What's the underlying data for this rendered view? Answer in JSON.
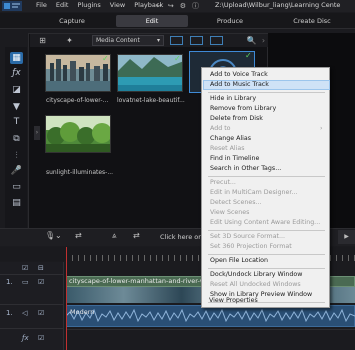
{
  "titlebar": {
    "menus": [
      "File",
      "Edit",
      "Plugins",
      "View",
      "Playback"
    ],
    "file_path": "Z:\\Upload\\Wilbur_liang\\Learning Cente"
  },
  "modes": {
    "capture": "Capture",
    "edit": "Edit",
    "produce": "Produce",
    "create_disc": "Create Disc"
  },
  "library": {
    "dropdown_value": "Media Content",
    "items": [
      {
        "caption": "cityscape-of-lower-...",
        "checked": true
      },
      {
        "caption": "lovatnet-lake-beautif...",
        "checked": true
      },
      {
        "caption": "sunlight-illuminates-...",
        "checked": false
      }
    ],
    "selected_item_checked": true
  },
  "context_menu": {
    "items": [
      {
        "label": "Add to Voice Track",
        "enabled": true
      },
      {
        "label": "Add to Music Track",
        "enabled": true,
        "highlighted": true
      },
      {
        "label": "Hide in Library",
        "enabled": true
      },
      {
        "label": "Remove from Library",
        "enabled": true
      },
      {
        "label": "Delete from Disk",
        "enabled": true
      },
      {
        "label": "Add to",
        "enabled": false
      },
      {
        "label": "Change Alias",
        "enabled": true
      },
      {
        "label": "Reset Alias",
        "enabled": false
      },
      {
        "label": "Find in Timeline",
        "enabled": true
      },
      {
        "label": "Search in Other Tags...",
        "enabled": true
      },
      {
        "label": "Precut...",
        "enabled": false
      },
      {
        "label": "Edit in MultiCam Designer...",
        "enabled": false
      },
      {
        "label": "Detect Scenes...",
        "enabled": false
      },
      {
        "label": "View Scenes",
        "enabled": false
      },
      {
        "label": "Edit Using Content Aware Editing...",
        "enabled": false
      },
      {
        "label": "Set 3D Source Format...",
        "enabled": false
      },
      {
        "label": "Set 360 Projection Format",
        "enabled": false
      },
      {
        "label": "Open File Location",
        "enabled": true
      },
      {
        "label": "Dock/Undock Library Window",
        "enabled": true
      },
      {
        "label": "Reset All Undocked Windows",
        "enabled": false
      },
      {
        "label": "Show in Library Preview Window",
        "enabled": true
      },
      {
        "label": "View Properties",
        "enabled": true
      }
    ]
  },
  "timeline": {
    "hint": "Click here or",
    "video_clip_label": "cityscape-of-lower-manhattan-and-river-with",
    "audio_clip_label": "Modern",
    "track_labels": [
      "1.",
      "1."
    ]
  }
}
